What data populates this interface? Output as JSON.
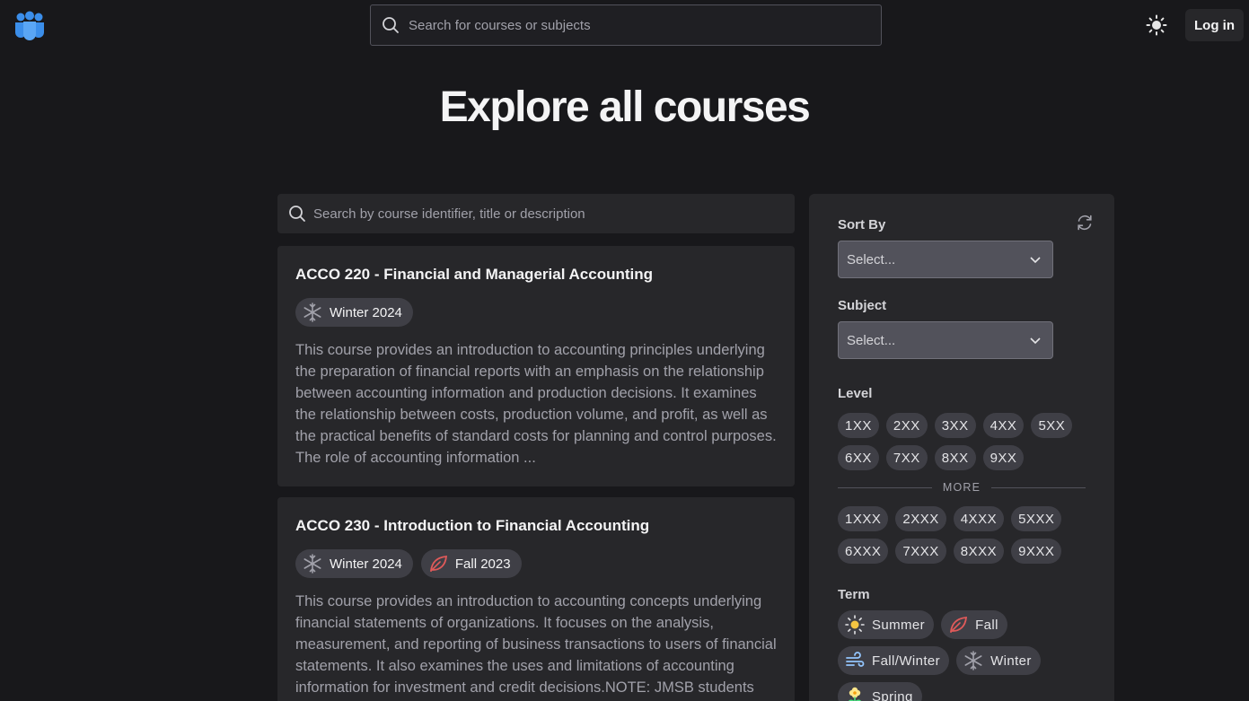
{
  "header": {
    "search_placeholder": "Search for courses or subjects",
    "login_label": "Log in"
  },
  "page_title": "Explore all courses",
  "course_search": {
    "placeholder": "Search by course identifier, title or description"
  },
  "courses": [
    {
      "title": "ACCO 220 - Financial and Managerial Accounting",
      "terms": [
        {
          "label": "Winter 2024",
          "icon": "snowflake-icon"
        }
      ],
      "description": "This course provides an introduction to accounting principles underlying the preparation of financial reports with an emphasis on the relationship between accounting information and production decisions. It examines the relationship between costs, production volume, and profit, as well as the practical benefits of standard costs for planning and control purposes. The role of accounting information ..."
    },
    {
      "title": "ACCO 230 - Introduction to Financial Accounting",
      "terms": [
        {
          "label": "Winter 2024",
          "icon": "snowflake-icon"
        },
        {
          "label": "Fall 2023",
          "icon": "leaf-icon"
        }
      ],
      "description": "This course provides an introduction to accounting concepts underlying financial statements of organizations. It focuses on the analysis, measurement, and reporting of business transactions to users of financial statements. It also examines the uses and limitations of accounting information for investment and credit decisions.NOTE: JMSB students"
    }
  ],
  "filters": {
    "sort_by": {
      "label": "Sort By",
      "value": "Select..."
    },
    "subject": {
      "label": "Subject",
      "value": "Select..."
    },
    "level": {
      "label": "Level",
      "row1": [
        "1XX",
        "2XX",
        "3XX",
        "4XX",
        "5XX"
      ],
      "row2": [
        "6XX",
        "7XX",
        "8XX",
        "9XX"
      ],
      "more_label": "MORE",
      "row3": [
        "1XXX",
        "2XXX",
        "4XXX",
        "5XXX"
      ],
      "row4": [
        "6XXX",
        "7XXX",
        "8XXX",
        "9XXX"
      ]
    },
    "term": {
      "label": "Term",
      "options": [
        "Summer",
        "Fall",
        "Fall/Winter",
        "Winter",
        "Spring"
      ]
    }
  },
  "colors": {
    "background": "#18181b",
    "surface": "#27272a",
    "chip": "#3f3f46",
    "logo_blue": "#3b8eea",
    "fall_red": "#e05a5a",
    "summer_yellow": "#f5c542"
  }
}
